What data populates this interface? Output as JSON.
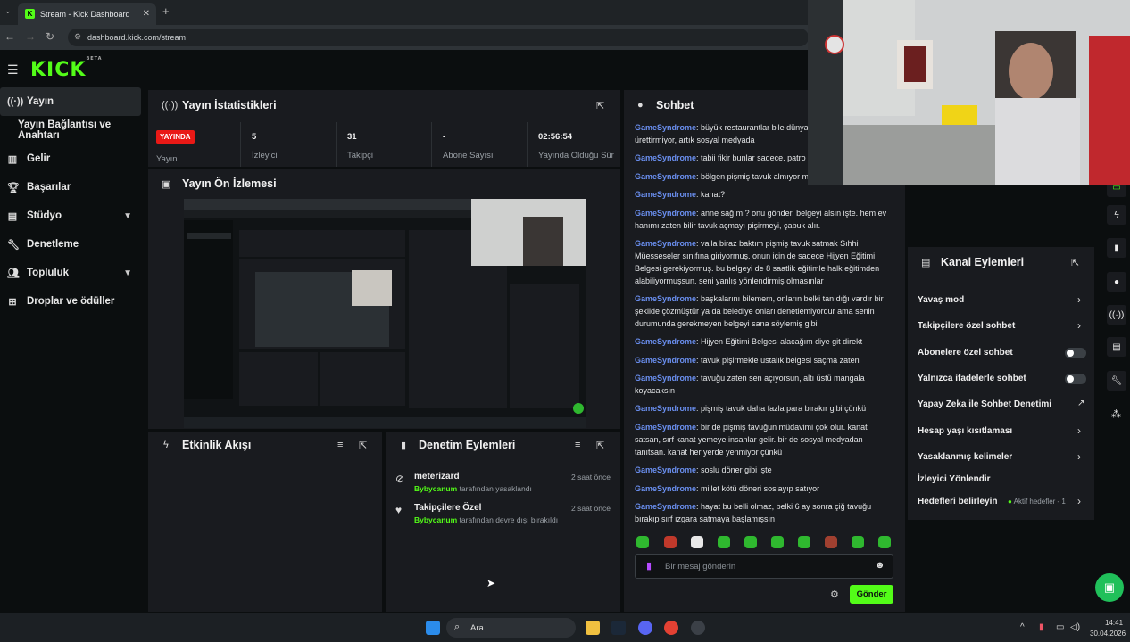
{
  "browser": {
    "tab_title": "Stream - Kick Dashboard",
    "tab_close": "✕",
    "new_tab": "+",
    "url": "dashboard.kick.com/stream"
  },
  "brand": {
    "logo": "KICK",
    "logo_sup": "BETA"
  },
  "sidebar": {
    "items": [
      {
        "label": "Yayın",
        "icon": "broadcast-icon"
      },
      {
        "label": "Yayın Bağlantısı ve Anahtarı",
        "icon": ""
      },
      {
        "label": "Gelir",
        "icon": "chart-icon"
      },
      {
        "label": "Başarılar",
        "icon": "trophy-icon"
      },
      {
        "label": "Stüdyo",
        "icon": "studio-icon"
      },
      {
        "label": "Denetleme",
        "icon": "wrench-icon"
      },
      {
        "label": "Topluluk",
        "icon": "people-icon"
      },
      {
        "label": "Droplar ve ödüller",
        "icon": "gift-icon"
      }
    ]
  },
  "stats": {
    "title": "Yayın İstatistikleri",
    "live_badge": "YAYINDA",
    "cells": [
      {
        "value": "",
        "label": "Yayın"
      },
      {
        "value": "5",
        "label": "İzleyici"
      },
      {
        "value": "31",
        "label": "Takipçi"
      },
      {
        "value": "-",
        "label": "Abone Sayısı"
      },
      {
        "value": "02:56:54",
        "label": "Yayında Olduğu Süre"
      }
    ]
  },
  "preview": {
    "title": "Yayın Ön İzlemesi"
  },
  "activity": {
    "title": "Etkinlik Akışı"
  },
  "mod_actions": {
    "title": "Denetim Eylemleri",
    "rows": [
      {
        "name": "meterizard",
        "by": "Bybycanum",
        "action": "tarafından yasaklandı",
        "time": "2 saat önce"
      },
      {
        "name": "Takipçilere Özel",
        "by": "Bybycanum",
        "action": "tarafından devre dışı bırakıldı",
        "time": "2 saat önce"
      }
    ]
  },
  "chat": {
    "title": "Sohbet",
    "messages": [
      {
        "user": "GameSyndrome",
        "text": "büyük restaurantlar bile dünya medya içeriği ürettirmiyor, artık sosyal medyada"
      },
      {
        "user": "GameSyndrome",
        "text": "tabii fikir bunlar sadece. patro"
      },
      {
        "user": "GameSyndrome",
        "text": "bölgen pişmiş tavuk almıyor mu"
      },
      {
        "user": "GameSyndrome",
        "text": "kanat?"
      },
      {
        "user": "GameSyndrome",
        "text": "anne sağ mı? onu gönder, belgeyi alsın işte. hem ev hanımı zaten bilir tavuk açmayı pişirmeyi, çabuk alır."
      },
      {
        "user": "GameSyndrome",
        "text": "valla biraz baktım pişmiş tavuk satmak Sıhhi Müesseseler sınıfına giriyormuş. onun için de sadece Hijyen Eğitimi Belgesi gerekiyormuş. bu belgeyi de 8 saatlik eğitimle halk eğitimden alabiliyormuşsun. seni yanlış yönlendirmiş olmasınlar"
      },
      {
        "user": "GameSyndrome",
        "text": "başkalarını bilemem, onların belki tanıdığı vardır bir şekilde çözmüştür ya da belediye onları denetlemiyordur ama senin durumunda gerekmeyen belgeyi sana söylemiş gibi"
      },
      {
        "user": "GameSyndrome",
        "text": "Hijyen Eğitimi Belgesi alacağım diye git direkt"
      },
      {
        "user": "GameSyndrome",
        "text": "tavuk pişirmekle ustalık belgesi saçma zaten"
      },
      {
        "user": "GameSyndrome",
        "text": "tavuğu zaten sen açıyorsun, altı üstü mangala koyacaksın"
      },
      {
        "user": "GameSyndrome",
        "text": "pişmiş tavuk daha fazla para bırakır gibi çünkü"
      },
      {
        "user": "GameSyndrome",
        "text": "bir de pişmiş tavuğun müdavimi çok olur. kanat satsan, sırf kanat yemeye insanlar gelir. bir de sosyal medyadan tanıtsan. kanat her yerde yenmiyor çünkü"
      },
      {
        "user": "GameSyndrome",
        "text": "soslu döner gibi işte"
      },
      {
        "user": "GameSyndrome",
        "text": "millet kötü döneri soslayıp satıyor"
      },
      {
        "user": "GameSyndrome",
        "text": "hayat bu belli olmaz, belki 6 ay sonra çiğ tavuğu bırakıp sırf ızgara satmaya başlamışsın"
      }
    ],
    "input_placeholder": "Bir mesaj gönderin",
    "send_label": "Gönder"
  },
  "channel_actions": {
    "title": "Kanal Eylemleri",
    "items": [
      {
        "label": "Yavaş mod",
        "control": "chevron"
      },
      {
        "label": "Takipçilere özel sohbet",
        "control": "chevron"
      },
      {
        "label": "Abonelere özel sohbet",
        "control": "toggle"
      },
      {
        "label": "Yalnızca ifadelerle sohbet",
        "control": "toggle"
      },
      {
        "label": "Yapay Zeka ile Sohbet Denetimi",
        "control": "external"
      },
      {
        "label": "Hesap yaşı kısıtlaması",
        "control": "chevron"
      },
      {
        "label": "Yasaklanmış kelimeler",
        "control": "chevron"
      },
      {
        "label": "İzleyici Yönlendir",
        "control": "none"
      },
      {
        "label": "Hedefleri belirleyin",
        "control": "chevron"
      }
    ],
    "goals_badge": "Aktif hedefler - 1"
  },
  "taskbar": {
    "search_label": "Ara",
    "time": "14:41",
    "date": "30.04.2026"
  },
  "colors": {
    "accent": "#53fc18",
    "live": "#e91916",
    "username": "#6a8ff0",
    "panel": "#191b1f"
  }
}
